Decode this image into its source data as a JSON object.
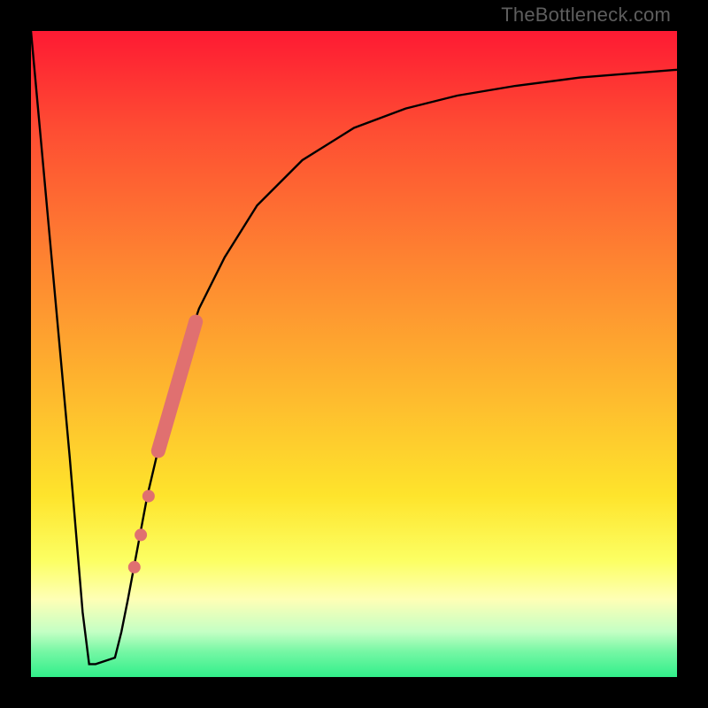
{
  "watermark": "TheBottleneck.com",
  "chart_data": {
    "type": "line",
    "title": "",
    "xlabel": "",
    "ylabel": "",
    "xlim": [
      0,
      100
    ],
    "ylim": [
      0,
      100
    ],
    "series": [
      {
        "name": "bottleneck-curve",
        "x": [
          0,
          6,
          8,
          9,
          10,
          13,
          14,
          15,
          18,
          22,
          26,
          30,
          35,
          42,
          50,
          58,
          66,
          75,
          85,
          95,
          100
        ],
        "values": [
          100,
          34,
          10,
          2,
          2,
          3,
          7,
          12,
          28,
          45,
          57,
          65,
          73,
          80,
          85,
          88,
          90,
          91.5,
          92.8,
          93.6,
          94
        ]
      }
    ],
    "markers": [
      {
        "name": "red-point",
        "x": 16.0,
        "y": 17
      },
      {
        "name": "red-point",
        "x": 17.0,
        "y": 22
      },
      {
        "name": "red-point",
        "x": 18.2,
        "y": 28
      },
      {
        "name": "red-segment",
        "x0": 19.7,
        "y0": 35,
        "x1": 25.5,
        "y1": 55
      }
    ],
    "colors": {
      "curve": "#000000",
      "marker": "#e07070"
    }
  }
}
